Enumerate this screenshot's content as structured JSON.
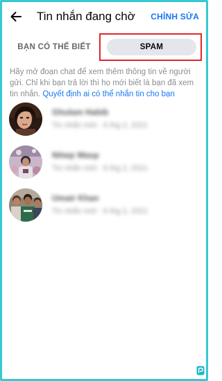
{
  "header": {
    "title": "Tin nhắn đang chờ",
    "edit_label": "CHỈNH SỬA"
  },
  "tabs": {
    "known_label": "BẠN CÓ THỂ BIẾT",
    "spam_label": "SPAM",
    "active": "spam"
  },
  "info": {
    "text": "Hãy mở đoạn chat để xem thêm thông tin về người gửi. Chỉ khi bạn trả lời thì họ mới biết là bạn đã xem tin nhắn.",
    "link": "Quyết định ai có thể nhắn tin cho bạn"
  },
  "conversations": [
    {
      "name": "Ghulam Habib",
      "meta": "Tin nhắn mới · 6 thg 2, 2021"
    },
    {
      "name": "Nitwp Wasp",
      "meta": "Tin nhắn mới · 6 thg 2, 2021"
    },
    {
      "name": "Umair Khan",
      "meta": "Tin nhắn mới · 6 thg 2, 2021"
    }
  ],
  "colors": {
    "accent": "#1877f2",
    "highlight_box": "#e0262b",
    "frame": "#37c9d3",
    "muted_text": "#8a8d91"
  },
  "icons": {
    "back": "arrow-left-icon",
    "corner": "app-badge-icon"
  }
}
